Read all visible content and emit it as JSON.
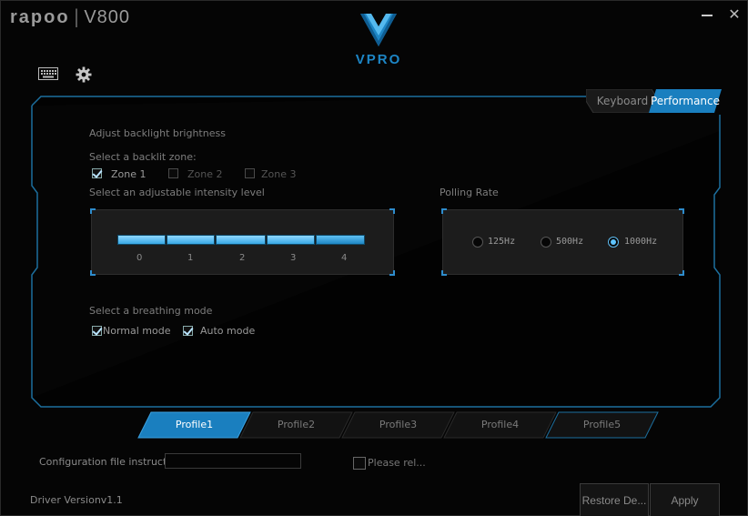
{
  "app": {
    "brand": "rapoo",
    "separator": "|",
    "model": "V800",
    "logo_text": "VPRO"
  },
  "window_buttons": {
    "minimize_icon": "minimize-icon",
    "close": "✕"
  },
  "toolbar": {
    "icons": [
      "keyboard-icon",
      "gear-icon"
    ]
  },
  "top_tabs": [
    {
      "label": "Keyboard",
      "active": false
    },
    {
      "label": "Performance",
      "active": true
    }
  ],
  "backlight": {
    "title": "Adjust backlight brightness",
    "zone_label": "Select a backlit zone:",
    "zones": [
      {
        "label": "Zone 1",
        "checked": true
      },
      {
        "label": "Zone 2",
        "checked": false
      },
      {
        "label": "Zone 3",
        "checked": false
      }
    ],
    "intensity_label": "Select an adjustable intensity level",
    "intensity_ticks": [
      "0",
      "1",
      "2",
      "3",
      "4"
    ],
    "intensity_level": 4
  },
  "polling": {
    "label": "Polling Rate",
    "options": [
      {
        "label": "125Hz",
        "selected": false
      },
      {
        "label": "500Hz",
        "selected": false
      },
      {
        "label": "1000Hz",
        "selected": true
      }
    ]
  },
  "breathing": {
    "label": "Select a breathing mode",
    "modes": [
      {
        "label": "Normal mode",
        "checked": true
      },
      {
        "label": "Auto mode",
        "checked": true
      }
    ]
  },
  "profiles": [
    {
      "label": "Profile1",
      "active": true
    },
    {
      "label": "Profile2",
      "active": false
    },
    {
      "label": "Profile3",
      "active": false
    },
    {
      "label": "Profile4",
      "active": false
    },
    {
      "label": "Profile5",
      "active": false
    }
  ],
  "config": {
    "label": "Configuration file instructions:",
    "value": ""
  },
  "please": {
    "label": "Please rel...",
    "checked": false
  },
  "driver_version": "Driver Versionv1.1",
  "buttons": {
    "restore": "Restore De...",
    "apply": "Apply"
  },
  "colors": {
    "accent": "#1d86c6",
    "active_tab": "#1a7fbf",
    "text": "#8a8a8a"
  }
}
